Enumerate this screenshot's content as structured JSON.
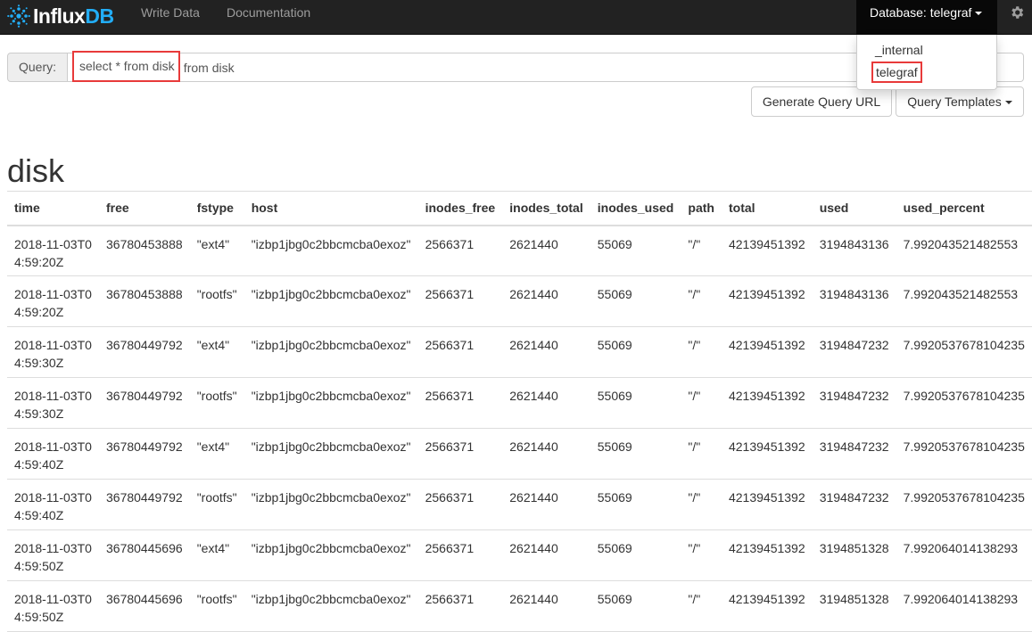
{
  "navbar": {
    "brand": {
      "name_part1": "Influx",
      "name_part2": "DB"
    },
    "links": [
      "Write Data",
      "Documentation"
    ],
    "database_label": "Database: telegraf"
  },
  "database_menu": {
    "items": [
      "_internal",
      "telegraf"
    ],
    "selected": "telegraf"
  },
  "query": {
    "label": "Query:",
    "value": "select * from disk"
  },
  "buttons": {
    "generate_url": "Generate Query URL",
    "templates": "Query Templates"
  },
  "result": {
    "series_name": "disk",
    "columns": [
      "time",
      "free",
      "fstype",
      "host",
      "inodes_free",
      "inodes_total",
      "inodes_used",
      "path",
      "total",
      "used",
      "used_percent"
    ],
    "rows": [
      [
        "2018-11-03T04:59:20Z",
        "36780453888",
        "\"ext4\"",
        "\"izbp1jbg0c2bbcmcba0exoz\"",
        "2566371",
        "2621440",
        "55069",
        "\"/\"",
        "42139451392",
        "3194843136",
        "7.992043521482553"
      ],
      [
        "2018-11-03T04:59:20Z",
        "36780453888",
        "\"rootfs\"",
        "\"izbp1jbg0c2bbcmcba0exoz\"",
        "2566371",
        "2621440",
        "55069",
        "\"/\"",
        "42139451392",
        "3194843136",
        "7.992043521482553"
      ],
      [
        "2018-11-03T04:59:30Z",
        "36780449792",
        "\"ext4\"",
        "\"izbp1jbg0c2bbcmcba0exoz\"",
        "2566371",
        "2621440",
        "55069",
        "\"/\"",
        "42139451392",
        "3194847232",
        "7.9920537678104235"
      ],
      [
        "2018-11-03T04:59:30Z",
        "36780449792",
        "\"rootfs\"",
        "\"izbp1jbg0c2bbcmcba0exoz\"",
        "2566371",
        "2621440",
        "55069",
        "\"/\"",
        "42139451392",
        "3194847232",
        "7.9920537678104235"
      ],
      [
        "2018-11-03T04:59:40Z",
        "36780449792",
        "\"ext4\"",
        "\"izbp1jbg0c2bbcmcba0exoz\"",
        "2566371",
        "2621440",
        "55069",
        "\"/\"",
        "42139451392",
        "3194847232",
        "7.9920537678104235"
      ],
      [
        "2018-11-03T04:59:40Z",
        "36780449792",
        "\"rootfs\"",
        "\"izbp1jbg0c2bbcmcba0exoz\"",
        "2566371",
        "2621440",
        "55069",
        "\"/\"",
        "42139451392",
        "3194847232",
        "7.9920537678104235"
      ],
      [
        "2018-11-03T04:59:50Z",
        "36780445696",
        "\"ext4\"",
        "\"izbp1jbg0c2bbcmcba0exoz\"",
        "2566371",
        "2621440",
        "55069",
        "\"/\"",
        "42139451392",
        "3194851328",
        "7.992064014138293"
      ],
      [
        "2018-11-03T04:59:50Z",
        "36780445696",
        "\"rootfs\"",
        "\"izbp1jbg0c2bbcmcba0exoz\"",
        "2566371",
        "2621440",
        "55069",
        "\"/\"",
        "42139451392",
        "3194851328",
        "7.992064014138293"
      ]
    ]
  },
  "colors": {
    "navbar_bg": "#222222",
    "brand_accent": "#22adf6",
    "highlight_border": "#e83a3a"
  },
  "icons": {
    "brand": "influxdb-logo-icon",
    "settings": "gear-icon",
    "dropdown": "caret-down-icon"
  }
}
